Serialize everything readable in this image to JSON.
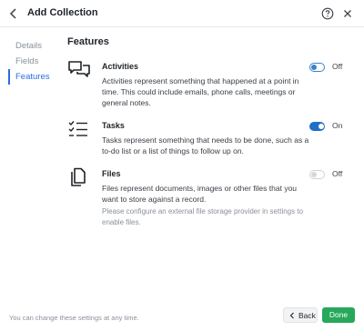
{
  "header": {
    "title": "Add Collection",
    "back_icon": "chevron-left-icon",
    "help_icon": "help-circle-icon",
    "close_icon": "close-icon"
  },
  "nav": {
    "items": [
      {
        "label": "Details",
        "active": false
      },
      {
        "label": "Fields",
        "active": false
      },
      {
        "label": "Features",
        "active": true
      }
    ]
  },
  "main": {
    "section_title": "Features",
    "features": [
      {
        "name": "Activities",
        "icon": "chat-bubbles-icon",
        "description": "Activities represent something that happened at a point in time. This could include emails, phone calls, meetings or general notes.",
        "toggle_state": "off",
        "toggle_label": "Off"
      },
      {
        "name": "Tasks",
        "icon": "checklist-icon",
        "description": "Tasks represent something that needs to be done, such as a to-do list or a list of things to follow up on.",
        "toggle_state": "on",
        "toggle_label": "On"
      },
      {
        "name": "Files",
        "icon": "files-icon",
        "description": "Files represent documents, images or other files that you want to store against a record.",
        "note": "Please configure an external file storage provider in settings to enable files.",
        "toggle_state": "disabled",
        "toggle_label": "Off"
      }
    ]
  },
  "footer": {
    "note": "You can change these settings at any time.",
    "back_label": "Back",
    "done_label": "Done"
  },
  "colors": {
    "accent": "#1f6fc5",
    "active_nav": "#2d6cdf",
    "done_button": "#27a85a"
  }
}
